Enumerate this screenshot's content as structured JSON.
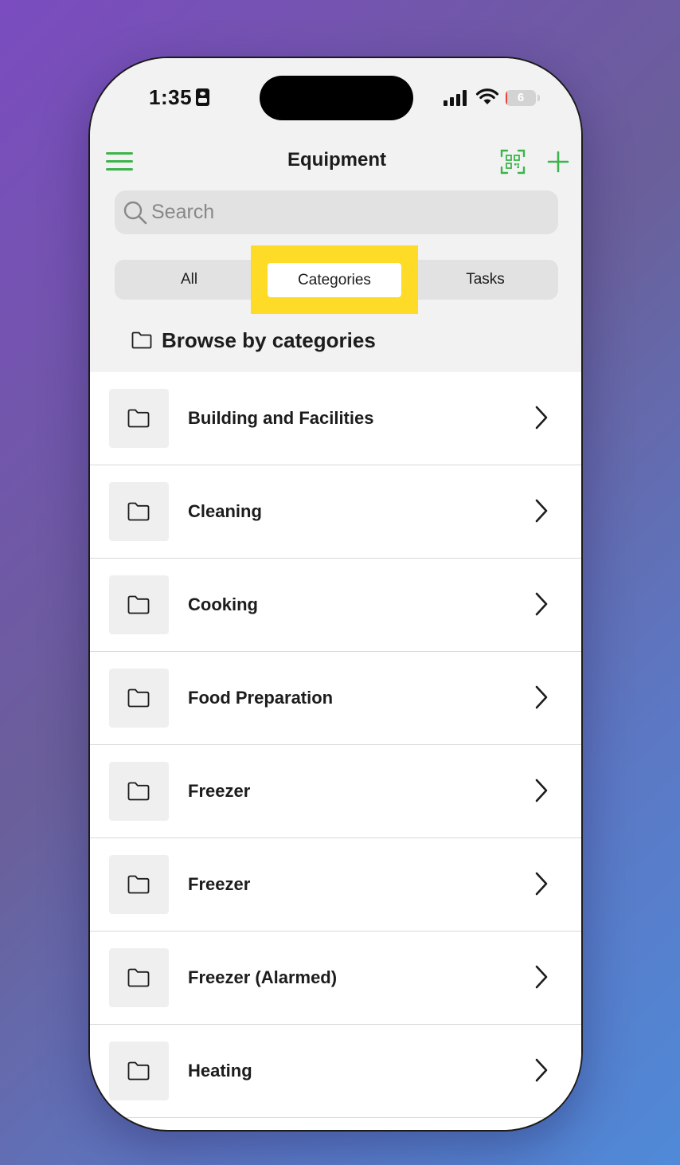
{
  "status_bar": {
    "time": "1:35",
    "battery_level": "6"
  },
  "nav": {
    "title": "Equipment"
  },
  "search": {
    "placeholder": "Search"
  },
  "segments": {
    "all": "All",
    "categories": "Categories",
    "tasks": "Tasks",
    "selected": "Categories"
  },
  "browse": {
    "title": "Browse by categories"
  },
  "categories": [
    {
      "label": "Building and Facilities"
    },
    {
      "label": "Cleaning"
    },
    {
      "label": "Cooking"
    },
    {
      "label": "Food Preparation"
    },
    {
      "label": "Freezer"
    },
    {
      "label": "Freezer"
    },
    {
      "label": "Freezer (Alarmed)"
    },
    {
      "label": "Heating"
    }
  ],
  "colors": {
    "accent": "#3cb44b",
    "highlight": "#fddb27",
    "header_bg": "#f2f2f2",
    "control_bg": "#e2e2e2"
  },
  "icons": {
    "menu": "hamburger-menu-icon",
    "scan": "qr-scan-icon",
    "add": "plus-icon",
    "search": "magnifier-icon",
    "folder": "folder-icon",
    "chevron": "chevron-right-icon"
  }
}
